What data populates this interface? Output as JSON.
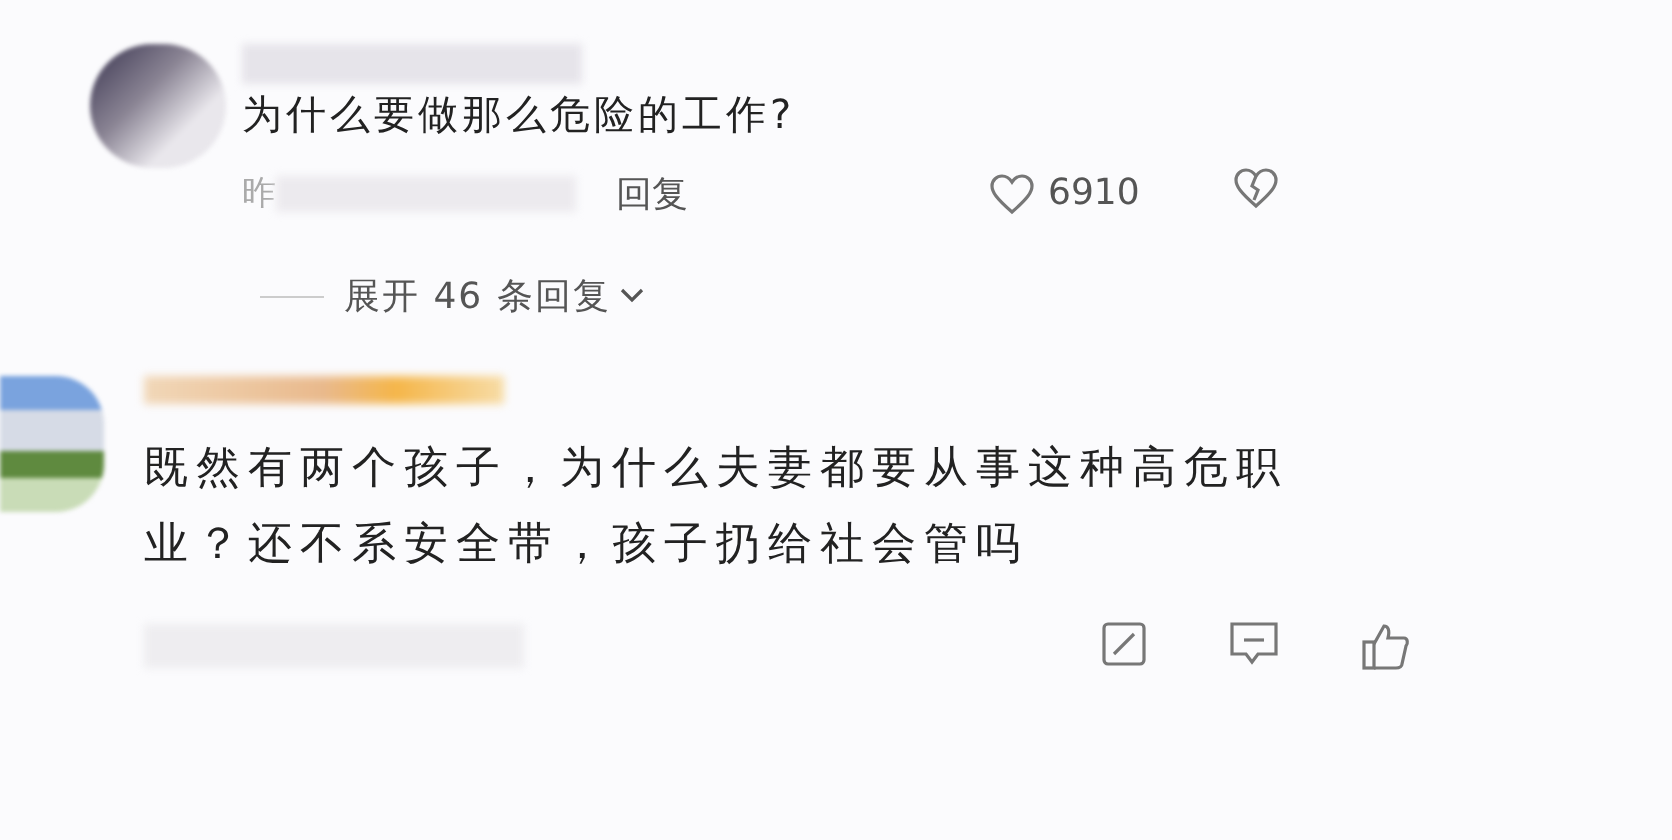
{
  "comments": [
    {
      "text": "为什么要做那么危险的工作?",
      "time_prefix": "昨",
      "reply": "回复",
      "likes": "6910",
      "expand": "展开 46 条回复"
    },
    {
      "text": "既然有两个孩子，为什么夫妻都要从事这种高危职业？还不系安全带，孩子扔给社会管吗"
    }
  ]
}
